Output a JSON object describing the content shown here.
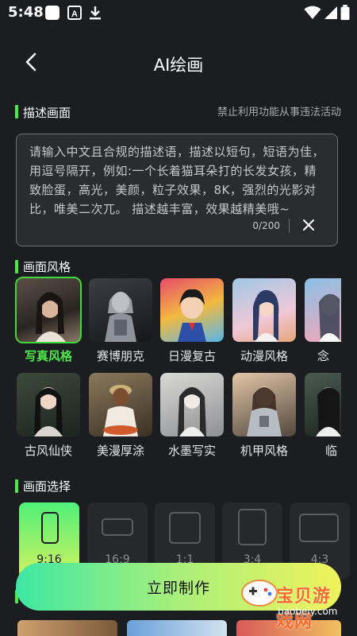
{
  "status_bar": {
    "time": "5:48",
    "icons": [
      "notification-square-icon",
      "a-icon",
      "download-icon",
      "wifi-icon",
      "signal-icon",
      "battery-icon"
    ]
  },
  "header": {
    "title": "AI绘画",
    "back_icon": "back-icon"
  },
  "describe": {
    "section_title": "描述画面",
    "notice": "禁止利用功能从事违法活动",
    "placeholder": "请输入中文且合规的描述语，描述以短句，短语为佳，用逗号隔开，例如:一个长着猫耳朵打的长发女孩，精致脸蛋，高光，美颜，粒子效果，8K，强烈的光影对比，唯美二次兀。 描述越丰富，效果越精美哦~",
    "counter": "0/200"
  },
  "style": {
    "section_title": "画面风格",
    "row1": [
      {
        "label": "写真风格",
        "selected": true
      },
      {
        "label": "赛博朋克"
      },
      {
        "label": "日漫复古"
      },
      {
        "label": "动漫风格"
      },
      {
        "label": "念"
      }
    ],
    "row2": [
      {
        "label": "古风仙侠"
      },
      {
        "label": "美漫厚涂"
      },
      {
        "label": "水墨写实"
      },
      {
        "label": "机甲风格"
      },
      {
        "label": "临"
      }
    ]
  },
  "ratio": {
    "section_title": "画面选择",
    "options": [
      "9:16",
      "16:9",
      "1:1",
      "3:4",
      "4:3"
    ],
    "selected": "9:16"
  },
  "action": {
    "label": "立即制作"
  },
  "watermark": {
    "text": "宝贝游戏网",
    "url": "baobeiy.com"
  },
  "colors": {
    "accent": "#4ee84a",
    "background": "#1b1d21",
    "button_start": "#3ee7a3",
    "button_end": "#f0f25a"
  }
}
